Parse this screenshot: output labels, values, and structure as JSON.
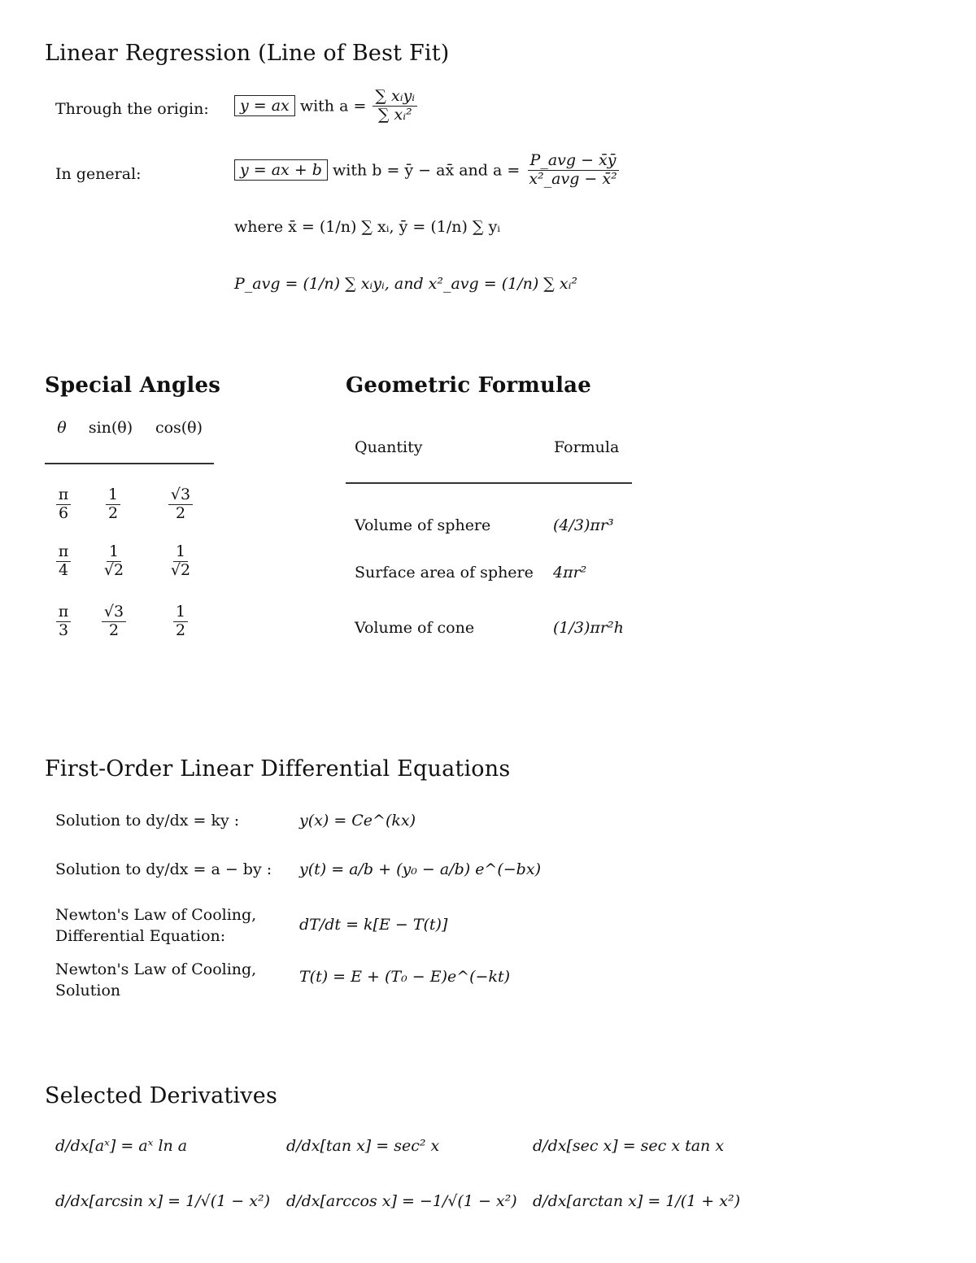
{
  "linear_regression": {
    "title": "Linear Regression (Line of Best Fit)",
    "origin_label": "Through the origin:",
    "origin_boxed": "y = ax",
    "origin_with": "with a =",
    "origin_a_num": "∑ xᵢyᵢ",
    "origin_a_den": "∑ xᵢ²",
    "general_label": "In general:",
    "general_boxed": "y = ax + b",
    "general_with": "with b = ȳ − ax̄ and a =",
    "general_a_num": "P_avg − x̄ȳ",
    "general_a_den": "x²_avg − x̄²",
    "where_line": "where x̄ = (1/n) ∑ xᵢ, ȳ = (1/n) ∑ yᵢ",
    "pavg_line": "P_avg = (1/n) ∑ xᵢyᵢ, and x²_avg = (1/n) ∑ xᵢ²"
  },
  "special_angles": {
    "title": "Special Angles",
    "headers": [
      "θ",
      "sin(θ)",
      "cos(θ)"
    ],
    "rows": [
      {
        "theta": [
          "π",
          "6"
        ],
        "sin": [
          "1",
          "2"
        ],
        "cos": [
          "√3",
          "2"
        ]
      },
      {
        "theta": [
          "π",
          "4"
        ],
        "sin": [
          "1",
          "√2"
        ],
        "cos": [
          "1",
          "√2"
        ]
      },
      {
        "theta": [
          "π",
          "3"
        ],
        "sin": [
          "√3",
          "2"
        ],
        "cos": [
          "1",
          "2"
        ]
      }
    ]
  },
  "geometric": {
    "title": "Geometric Formulae",
    "headers": [
      "Quantity",
      "Formula"
    ],
    "rows": [
      {
        "quantity": "Volume of sphere",
        "formula": "(4/3)πr³"
      },
      {
        "quantity": "Surface area of sphere",
        "formula": "4πr²"
      },
      {
        "quantity": "Volume of cone",
        "formula": "(1/3)πr²h"
      }
    ]
  },
  "diffeq": {
    "title": "First-Order Linear Differential Equations",
    "rows": [
      {
        "label": "Solution to dy/dx = ky :",
        "formula": "y(x) = Ce^(kx)"
      },
      {
        "label": "Solution to dy/dx = a − by :",
        "formula": "y(t) = a/b + (y₀ − a/b) e^(−bx)"
      },
      {
        "label_line1": "Newton's Law of Cooling,",
        "label_line2": "Differential Equation:",
        "formula": "dT/dt = k[E − T(t)]"
      },
      {
        "label_line1": "Newton's Law of Cooling,",
        "label_line2": "Solution",
        "formula": "T(t) = E + (T₀ − E)e^(−kt)"
      }
    ]
  },
  "derivatives": {
    "title": "Selected Derivatives",
    "items": [
      "d/dx[aˣ] = aˣ ln a",
      "d/dx[tan x] = sec² x",
      "d/dx[sec x] = sec x tan x",
      "d/dx[arcsin x] = 1/√(1 − x²)",
      "d/dx[arccos x] = −1/√(1 − x²)",
      "d/dx[arctan x] = 1/(1 + x²)"
    ]
  }
}
